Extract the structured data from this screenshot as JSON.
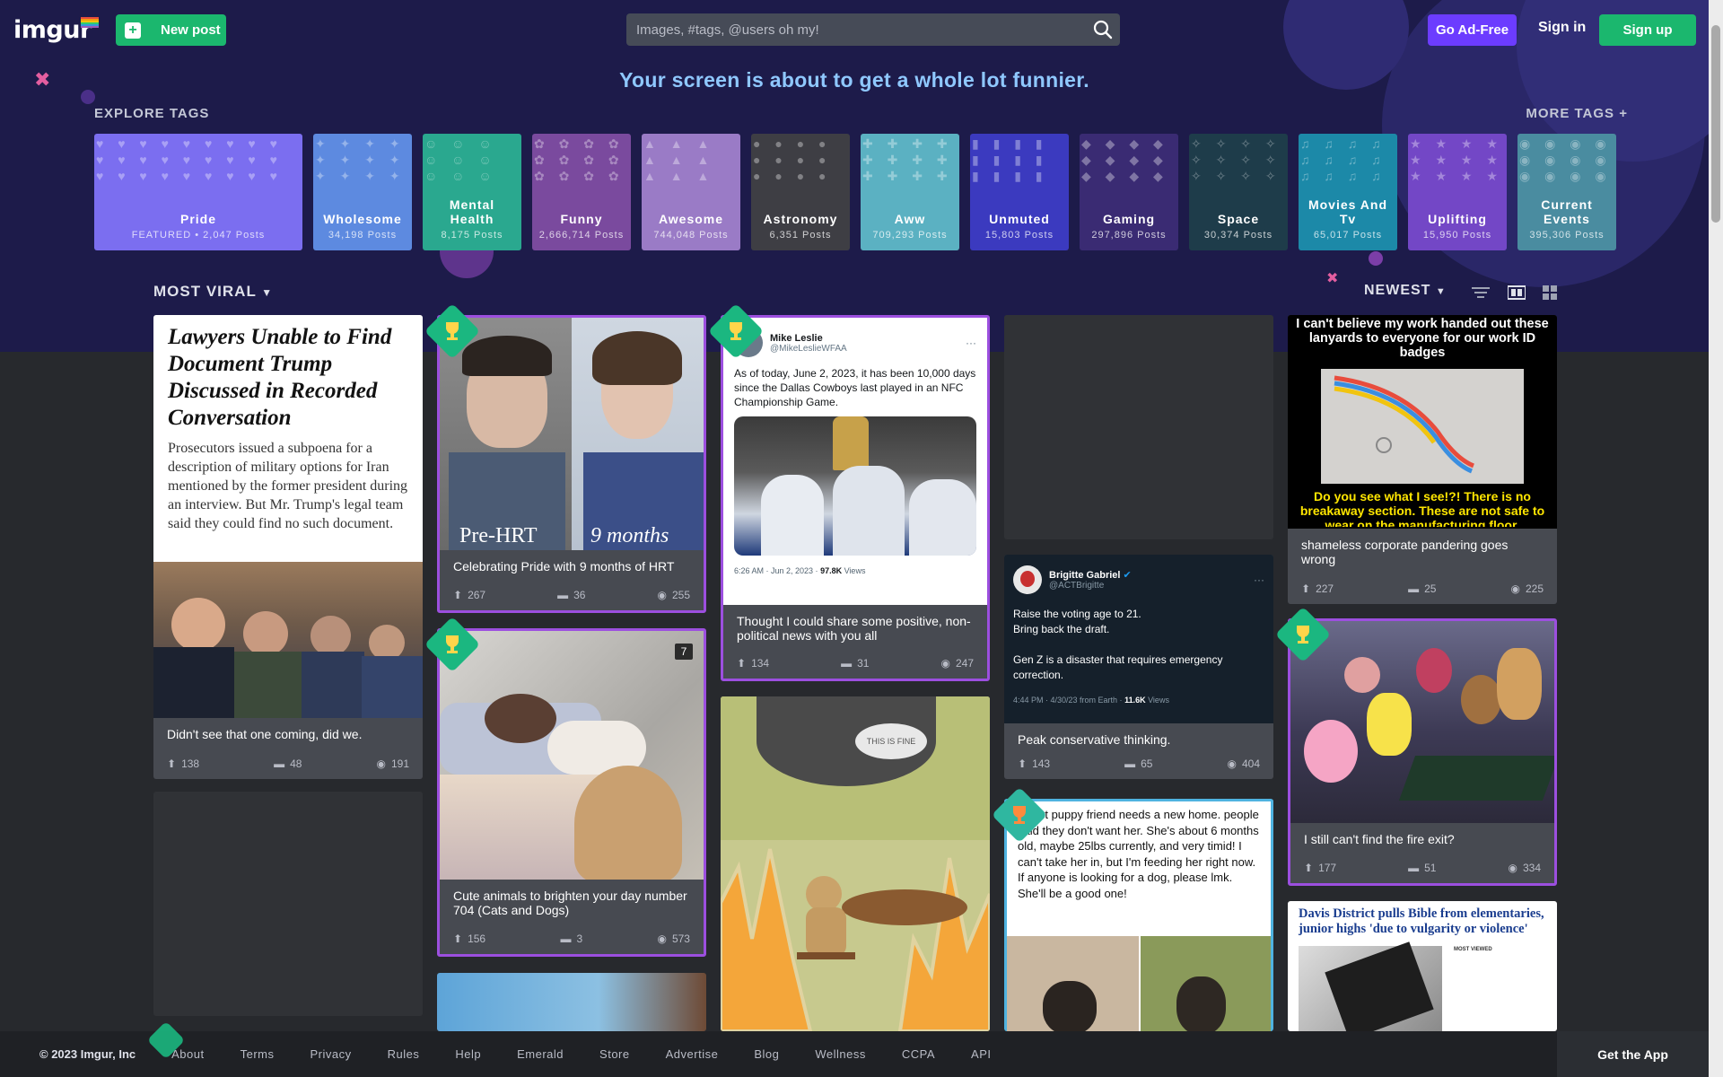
{
  "header": {
    "logo_text": "imgur",
    "new_post_label": "New post",
    "search_placeholder": "Images, #tags, @users oh my!",
    "go_adfree_label": "Go Ad-Free",
    "signin_label": "Sign in",
    "signup_label": "Sign up"
  },
  "banner": {
    "tagline": "Your screen is about to get a whole lot funnier."
  },
  "explore": {
    "label": "EXPLORE TAGS",
    "more_label": "MORE TAGS +",
    "tags": [
      {
        "name": "Pride",
        "posts": "FEATURED • 2,047 Posts",
        "color": "#7b6ef0"
      },
      {
        "name": "Wholesome",
        "posts": "34,198 Posts",
        "color": "#5d8ae0"
      },
      {
        "name": "Mental Health",
        "posts": "8,175 Posts",
        "color": "#2aa88f"
      },
      {
        "name": "Funny",
        "posts": "2,666,714 Posts",
        "color": "#7a4a9e"
      },
      {
        "name": "Awesome",
        "posts": "744,048 Posts",
        "color": "#9a7bc6"
      },
      {
        "name": "Astronomy",
        "posts": "6,351 Posts",
        "color": "#3e3e44"
      },
      {
        "name": "Aww",
        "posts": "709,293 Posts",
        "color": "#5bb1c2"
      },
      {
        "name": "Unmuted",
        "posts": "15,803 Posts",
        "color": "#3b3abf"
      },
      {
        "name": "Gaming",
        "posts": "297,896 Posts",
        "color": "#3a2b73"
      },
      {
        "name": "Space",
        "posts": "30,374 Posts",
        "color": "#1e3c4a"
      },
      {
        "name": "Movies And Tv",
        "posts": "65,017 Posts",
        "color": "#1c89a8"
      },
      {
        "name": "Uplifting",
        "posts": "15,950 Posts",
        "color": "#7347c6"
      },
      {
        "name": "Current Events",
        "posts": "395,306 Posts",
        "color": "#4a8ca0"
      }
    ]
  },
  "gallery": {
    "sort_label": "MOST VIRAL",
    "order_label": "NEWEST"
  },
  "cards": {
    "c1": {
      "headline": "Lawyers Unable to Find Document Trump Discussed in Recorded Conversation",
      "body": "Prosecutors issued a subpoena for a description of military options for Iran mentioned by the former president during an interview. But Mr. Trump's legal team said they could find no such document.",
      "title": "Didn't see that one coming, did we.",
      "ups": "138",
      "comments": "48",
      "views": "191"
    },
    "c2": {
      "caption_left": "Pre-HRT",
      "caption_right": "9 months",
      "title": "Celebrating Pride with 9 months of HRT",
      "ups": "267",
      "comments": "36",
      "views": "255"
    },
    "c3": {
      "author": "Mike Leslie",
      "handle": "@MikeLeslieWFAA",
      "text": "As of today, June 2, 2023, it has been 10,000 days since the Dallas Cowboys last played in an NFC Championship Game.",
      "meta_time": "6:26 AM · Jun 2, 2023 · ",
      "meta_views_num": "97.8K",
      "meta_views_label": " Views",
      "title": "Thought I could share some positive, non-political news with you all",
      "ups": "134",
      "comments": "31",
      "views": "247"
    },
    "c4": {
      "author": "Brigitte Gabriel",
      "handle": "@ACTBrigitte",
      "text1": "Raise the voting age to 21.",
      "text2": "Bring back the draft.",
      "text3": "Gen Z is a disaster that requires emergency correction.",
      "meta_time": "4:44 PM · 4/30/23 from Earth · ",
      "meta_views_num": "11.6K",
      "meta_views_label": " Views",
      "title": "Peak conservative thinking.",
      "ups": "143",
      "comments": "65",
      "views": "404"
    },
    "c5": {
      "top_text": "I can't believe my work handed out these lanyards to everyone for our work ID badges",
      "bottom_text": "Do you see what I see!?! There is no breakaway section. These are not safe to wear on the manufacturing floor.",
      "title": "shameless corporate pandering goes wrong",
      "ups": "227",
      "comments": "25",
      "views": "225"
    },
    "c6": {
      "badge": "7",
      "title": "Cute animals to brighten your day number 704 (Cats and Dogs)",
      "ups": "156",
      "comments": "3",
      "views": "573"
    },
    "c7": {
      "title": "I still can't find the fire exit?",
      "ups": "177",
      "comments": "51",
      "views": "334"
    },
    "c8": {
      "bubble": "THIS IS FINE"
    },
    "c9": {
      "text": "sweet puppy friend needs a new home. people said they don't want her. She's about 6 months old, maybe 25lbs currently, and very timid! I can't take her in, but I'm feeding her right now. If anyone is looking for a dog, please lmk. She'll be a good one!"
    },
    "c10": {
      "headline": "Davis District pulls Bible from elementaries, junior highs 'due to vulgarity or violence'",
      "sidebar_label": "MOST VIEWED"
    }
  },
  "footer": {
    "copyright": "© 2023 Imgur, Inc",
    "links": [
      "About",
      "Terms",
      "Privacy",
      "Rules",
      "Help",
      "Emerald",
      "Store",
      "Advertise",
      "Blog",
      "Wellness",
      "CCPA",
      "API"
    ],
    "get_app": "Get the App"
  }
}
